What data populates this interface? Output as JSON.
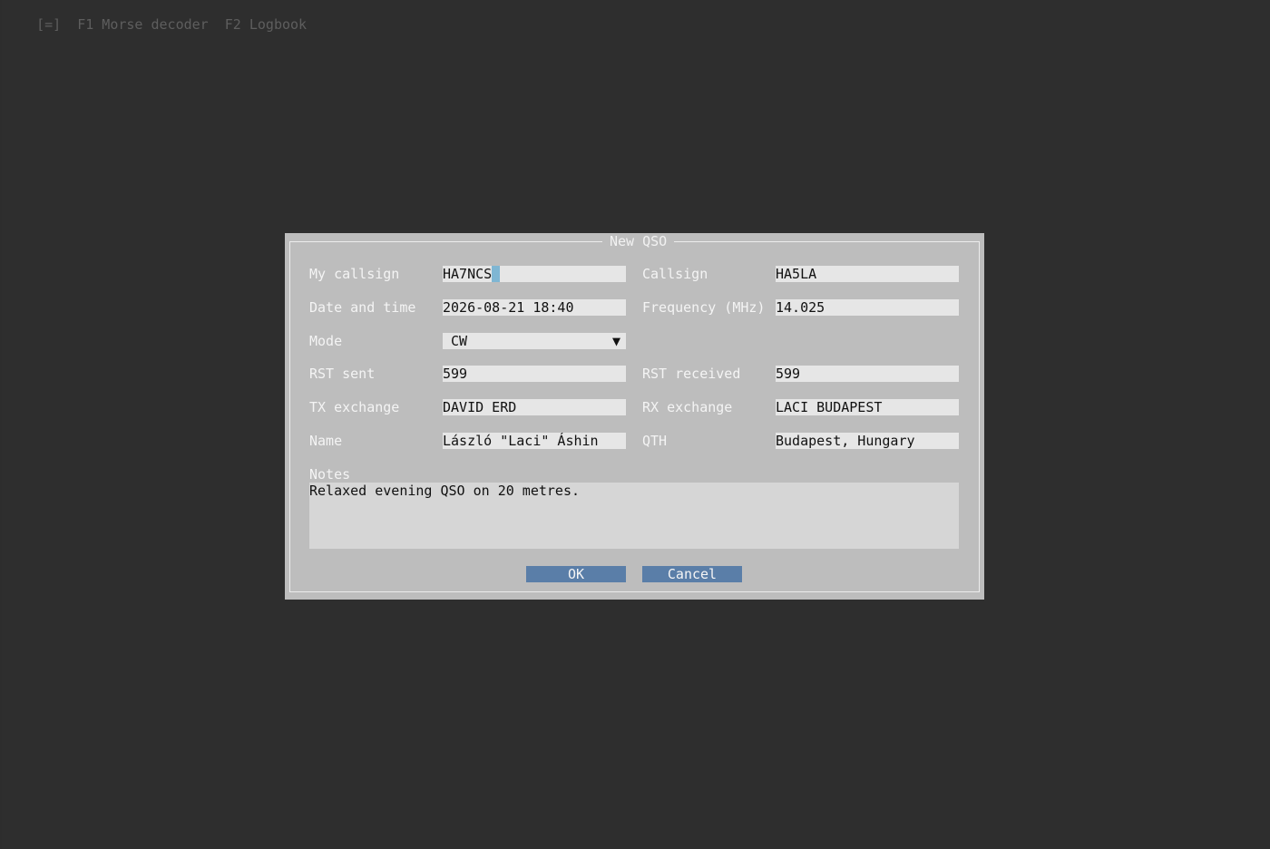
{
  "menubar": {
    "menu_symbol": "[=]",
    "items": [
      {
        "label": "F1 Morse decoder"
      },
      {
        "label": "F2 Logbook"
      }
    ]
  },
  "dialog": {
    "title": "New QSO",
    "fields": {
      "my_callsign": {
        "label": "My callsign",
        "value": "HA7NCS"
      },
      "callsign": {
        "label": "Callsign",
        "value": "HA5LA"
      },
      "date_time": {
        "label": "Date and time",
        "value": "2026-08-21 18:40"
      },
      "frequency": {
        "label": "Frequency (MHz)",
        "value": "14.025"
      },
      "mode": {
        "label": "Mode",
        "value": "CW",
        "arrow": "▼"
      },
      "rst_sent": {
        "label": "RST sent",
        "value": "599"
      },
      "rst_received": {
        "label": "RST received",
        "value": "599"
      },
      "tx_exchange": {
        "label": "TX exchange",
        "value": "DAVID ERD"
      },
      "rx_exchange": {
        "label": "RX exchange",
        "value": "LACI BUDAPEST"
      },
      "name": {
        "label": "Name",
        "value": "László \"Laci\" Áshin"
      },
      "qth": {
        "label": "QTH",
        "value": "Budapest, Hungary"
      },
      "notes": {
        "label": "Notes",
        "value": "Relaxed evening QSO on 20 metres."
      }
    },
    "buttons": {
      "ok": "OK",
      "cancel": "Cancel"
    }
  },
  "colors": {
    "background": "#2e2e2e",
    "dialog": "#bdbdbd",
    "field": "#e6e6e6",
    "button": "#5a7ea8",
    "cursor": "#7fb6d3"
  }
}
